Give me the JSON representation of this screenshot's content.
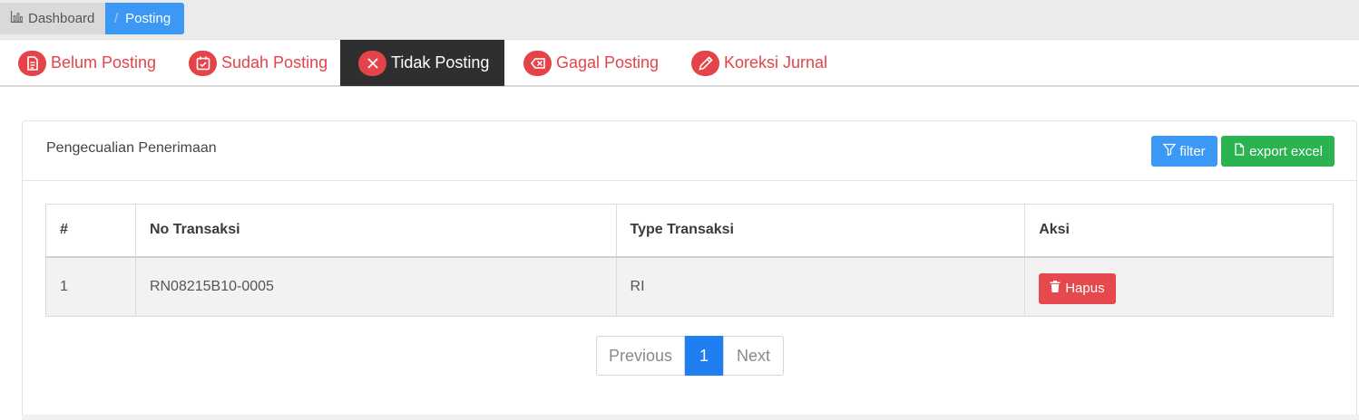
{
  "breadcrumb": {
    "home": "Dashboard",
    "separator": "/",
    "current": "Posting"
  },
  "tabs": [
    {
      "label": "Belum Posting",
      "icon": "document-icon"
    },
    {
      "label": "Sudah Posting",
      "icon": "calendar-check-icon"
    },
    {
      "label": "Tidak Posting",
      "icon": "close-icon",
      "active": true
    },
    {
      "label": "Gagal Posting",
      "icon": "backspace-x-icon"
    },
    {
      "label": "Koreksi Jurnal",
      "icon": "pen-icon"
    }
  ],
  "card": {
    "title": "Pengecualian Penerimaan",
    "filter_label": "filter",
    "export_label": "export excel"
  },
  "table": {
    "headers": [
      "#",
      "No Transaksi",
      "Type Transaksi",
      "Aksi"
    ],
    "rows": [
      {
        "no": "1",
        "no_transaksi": "RN08215B10-0005",
        "type": "RI",
        "action": "Hapus"
      }
    ]
  },
  "pagination": {
    "previous": "Previous",
    "current": "1",
    "next": "Next"
  },
  "colors": {
    "primary": "#3b99f5",
    "success": "#2bb350",
    "danger": "#e5434a",
    "active_tab": "#2f2f2f"
  }
}
